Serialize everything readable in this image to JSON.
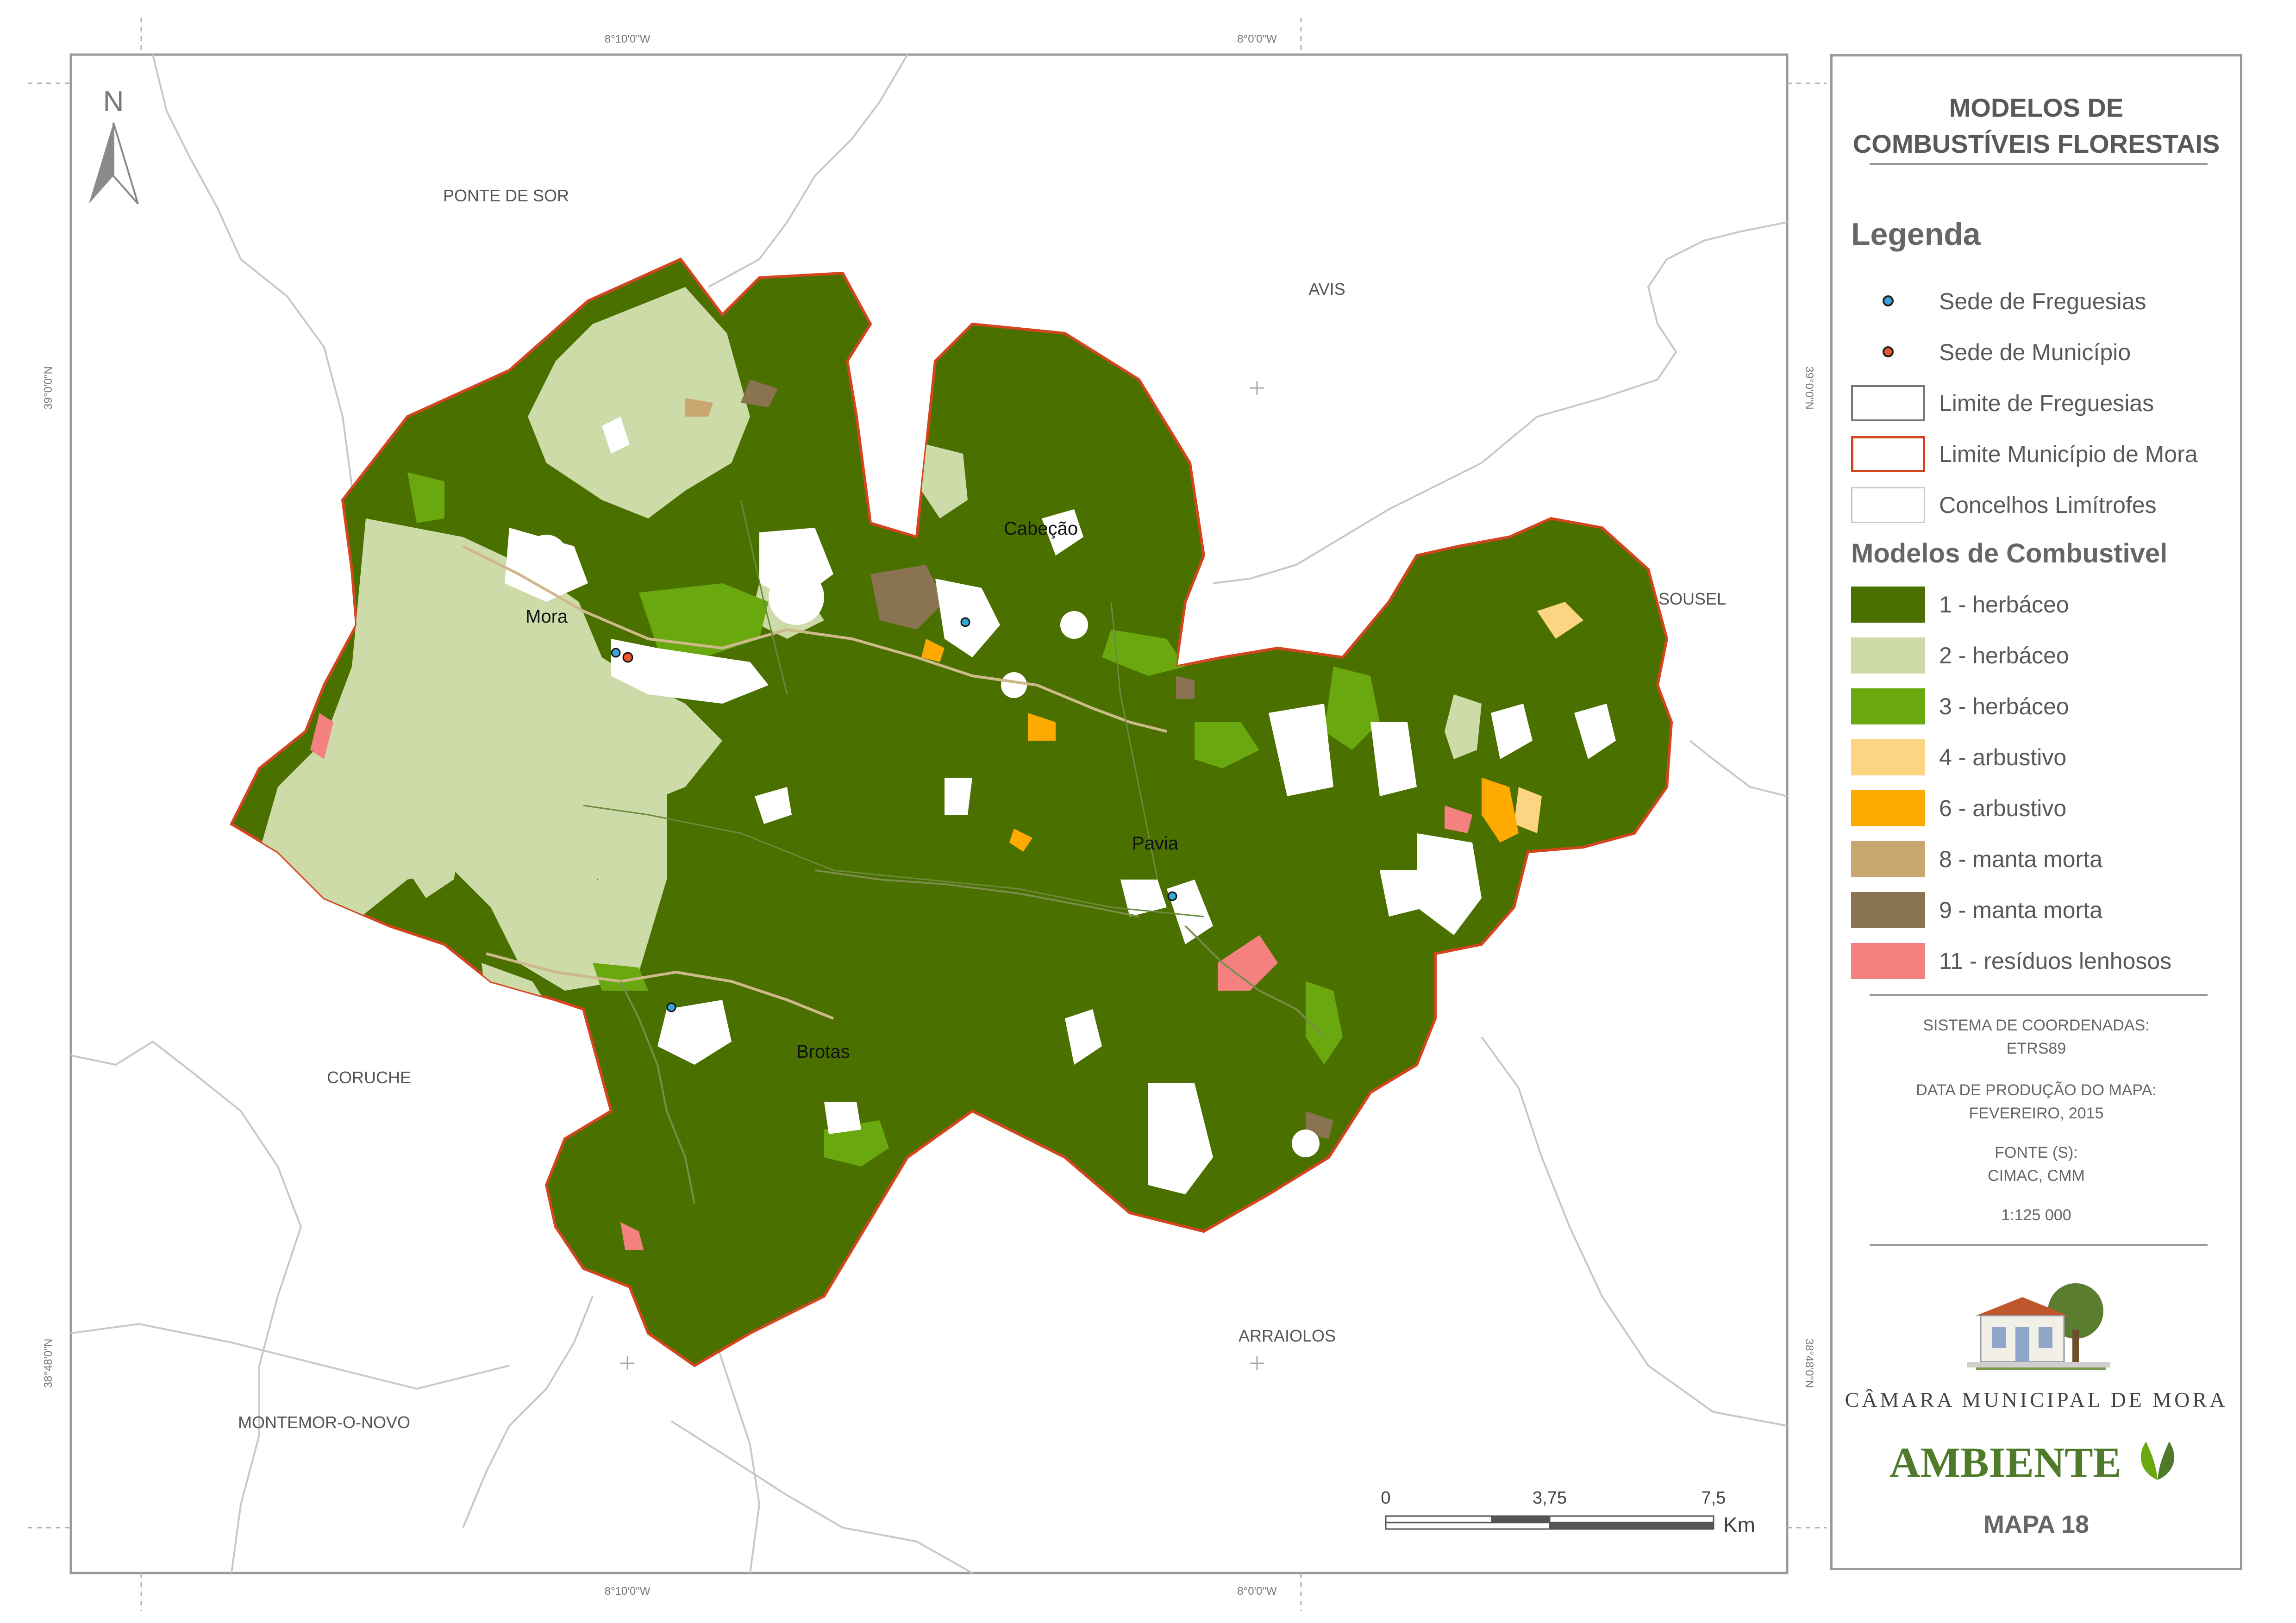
{
  "colors": {
    "herb1": "#4a7000",
    "herb2": "#cddba9",
    "herb3": "#6aa80f",
    "arb4": "#fdd482",
    "arb6": "#ffaa00",
    "manta8": "#cba770",
    "manta9": "#8a7350",
    "res11": "#f58080",
    "municipio_border": "#d2451e",
    "freguesia_dot": "#3ba3d8",
    "municipio_dot": "#e8552a"
  },
  "map": {
    "north_label": "N",
    "graticule": {
      "top_left": "8°10'0\"W",
      "top_right": "8°0'0\"W",
      "bottom_left": "8°10'0\"W",
      "bottom_right": "8°0'0\"W",
      "left_top": "39°0'0\"N",
      "left_bottom": "38°48'0\"N",
      "right_top": "39°0'0\"N",
      "right_bottom": "38°48'0\"N"
    },
    "concelhos": {
      "ponte_de_sor": "PONTE DE SOR",
      "avis": "AVIS",
      "sousel": "SOUSEL",
      "coruche": "CORUCHE",
      "arraiolos": "ARRAIOLOS",
      "montemor": "MONTEMOR-O-NOVO"
    },
    "freguesias": {
      "mora": "Mora",
      "cabecao": "Cabeção",
      "pavia": "Pavia",
      "brotas": "Brotas"
    },
    "scalebar": {
      "t0": "0",
      "t1": "3,75",
      "t2": "7,5",
      "unit": "Km"
    }
  },
  "panel": {
    "title_line1": "MODELOS DE",
    "title_line2": "COMBUSTÍVEIS FLORESTAIS",
    "legend_title": "Legenda",
    "legend": {
      "sede_freguesias": "Sede de Freguesias",
      "sede_municipio": "Sede de Município",
      "limite_freguesias": "Limite de Freguesias",
      "limite_municipio": "Limite Município de Mora",
      "concelhos": "Concelhos Limítrofes"
    },
    "models_title": "Modelos de Combustivel",
    "models": [
      {
        "label": "1 - herbáceo",
        "color": "#4a7000"
      },
      {
        "label": "2 - herbáceo",
        "color": "#cddba9"
      },
      {
        "label": "3 - herbáceo",
        "color": "#6aa80f"
      },
      {
        "label": "4 - arbustivo",
        "color": "#fdd482"
      },
      {
        "label": "6 - arbustivo",
        "color": "#ffaa00"
      },
      {
        "label": "8 - manta morta",
        "color": "#cba770"
      },
      {
        "label": "9 - manta morta",
        "color": "#8a7350"
      },
      {
        "label": "11 - resíduos lenhosos",
        "color": "#f58080"
      }
    ],
    "coords_label": "SISTEMA DE COORDENADAS:",
    "coords_value": "ETRS89",
    "date_label": "DATA DE PRODUÇÃO DO MAPA:",
    "date_value": "FEVEREIRO, 2015",
    "source_label": "FONTE (S):",
    "source_value": "CIMAC, CMM",
    "scale": "1:125 000",
    "org_name": "CÂMARA MUNICIPAL DE MORA",
    "ambiente": "AMBIENTE",
    "map_number": "MAPA 18"
  }
}
